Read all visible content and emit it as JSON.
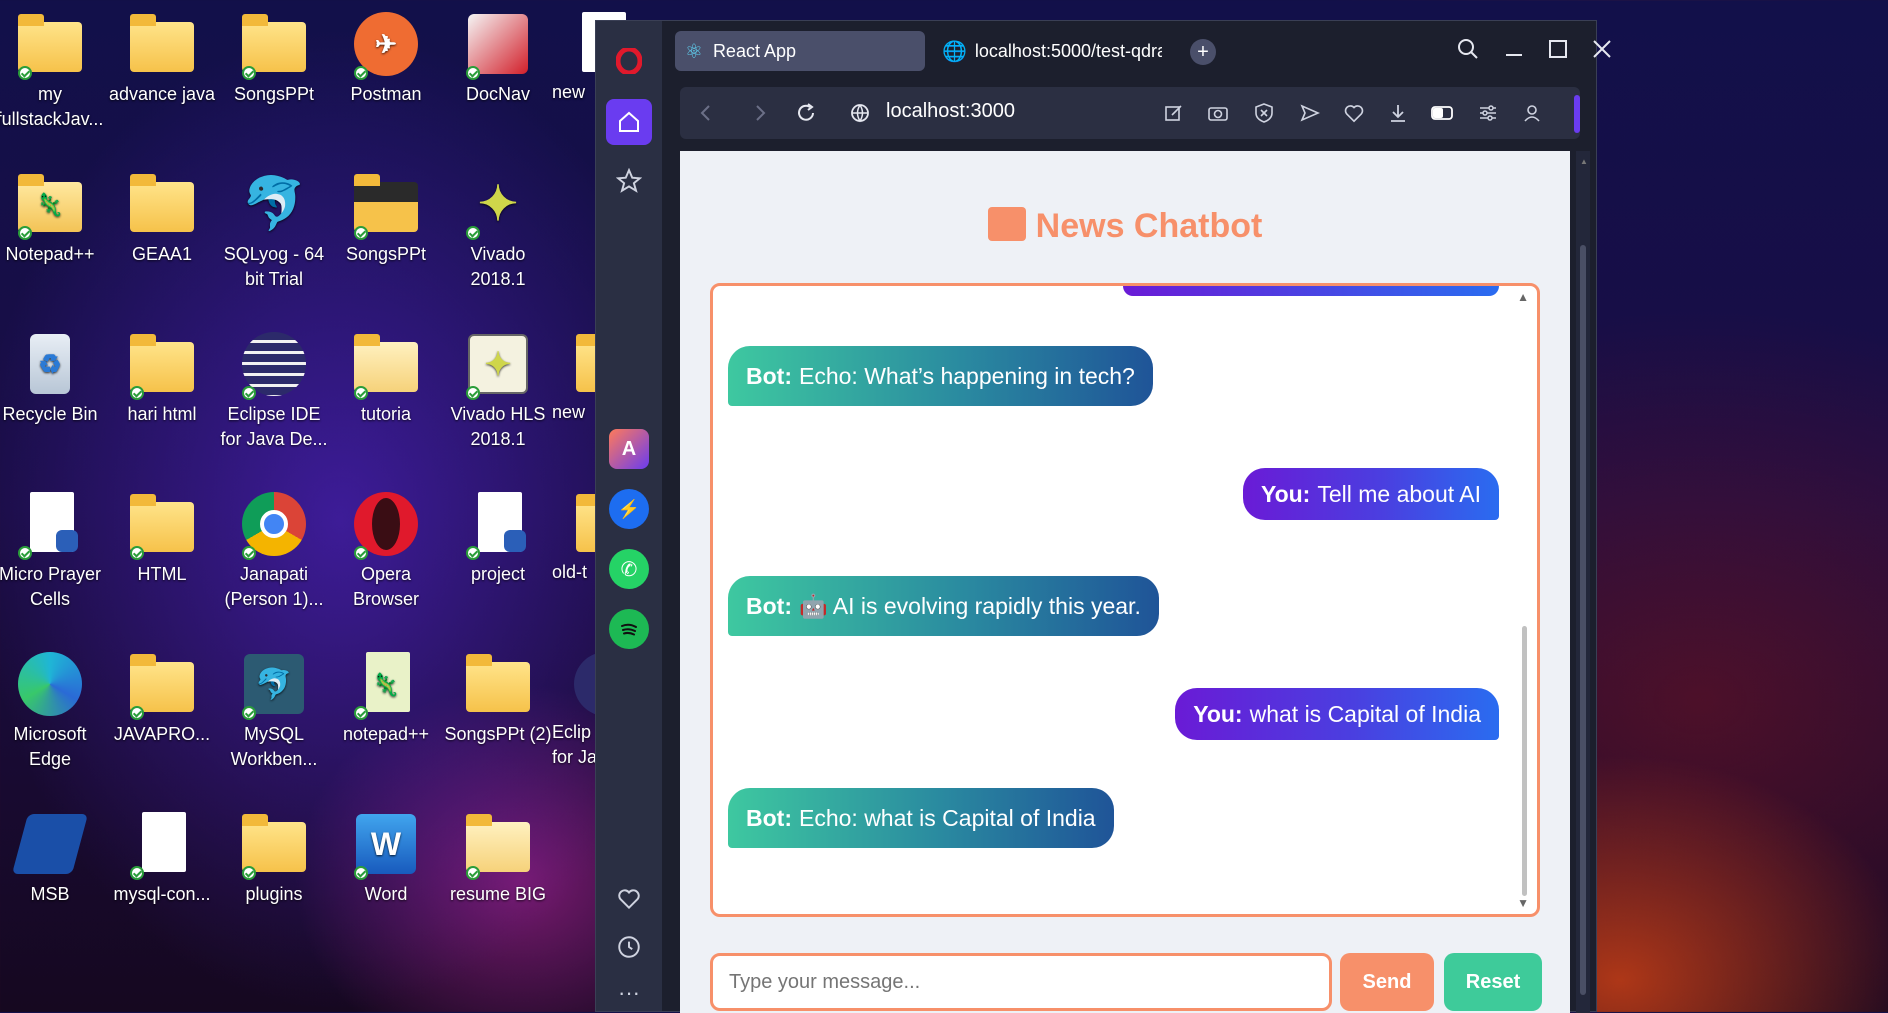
{
  "desktop": {
    "icons": [
      {
        "label": "my fullstackJav..."
      },
      {
        "label": "advance java"
      },
      {
        "label": "SongsPPt"
      },
      {
        "label": "Postman"
      },
      {
        "label": "DocNav"
      },
      {
        "label": "new"
      },
      {
        "label": "Notepad++"
      },
      {
        "label": "GEAA1"
      },
      {
        "label": "SQLyog - 64 bit Trial"
      },
      {
        "label": "SongsPPt"
      },
      {
        "label": "Vivado 2018.1"
      },
      {
        "label": "Recycle Bin"
      },
      {
        "label": "hari html"
      },
      {
        "label": "Eclipse IDE for Java De..."
      },
      {
        "label": "tutoria"
      },
      {
        "label": "Vivado HLS 2018.1"
      },
      {
        "label": "new"
      },
      {
        "label": "Micro Prayer Cells"
      },
      {
        "label": "HTML"
      },
      {
        "label": "Janapati (Person 1)..."
      },
      {
        "label": "Opera Browser"
      },
      {
        "label": "project"
      },
      {
        "label": "old-t"
      },
      {
        "label": "Microsoft Edge"
      },
      {
        "label": "JAVAPRO..."
      },
      {
        "label": "MySQL Workben..."
      },
      {
        "label": "notepad++"
      },
      {
        "label": "SongsPPt (2)"
      },
      {
        "label": "Eclip for Ja"
      },
      {
        "label": "MSB"
      },
      {
        "label": "mysql-con..."
      },
      {
        "label": "plugins"
      },
      {
        "label": "Word"
      },
      {
        "label": "resume BIG"
      }
    ]
  },
  "browser": {
    "tabs": [
      {
        "label": "React App",
        "icon": "react-icon"
      },
      {
        "label": "localhost:5000/test-qdrant",
        "icon": "globe-icon"
      }
    ],
    "address": "localhost:3000"
  },
  "app": {
    "title_emoji": "📙",
    "title": "News Chatbot",
    "messages": [
      {
        "sender": "Bot:",
        "text": "Echo: What’s happening in tech?"
      },
      {
        "sender": "You:",
        "text": "Tell me about AI"
      },
      {
        "sender": "Bot:",
        "text": "🤖 AI is evolving rapidly this year."
      },
      {
        "sender": "You:",
        "text": "what is Capital of India"
      },
      {
        "sender": "Bot:",
        "text": "Echo: what is Capital of India"
      }
    ],
    "input_placeholder": "Type your message...",
    "send_label": "Send",
    "reset_label": "Reset"
  },
  "colors": {
    "accent": "#f7906a",
    "reset": "#3ecb9a",
    "you_gradient_start": "#6a1bd6",
    "bot_gradient_start": "#3ec8a0"
  }
}
